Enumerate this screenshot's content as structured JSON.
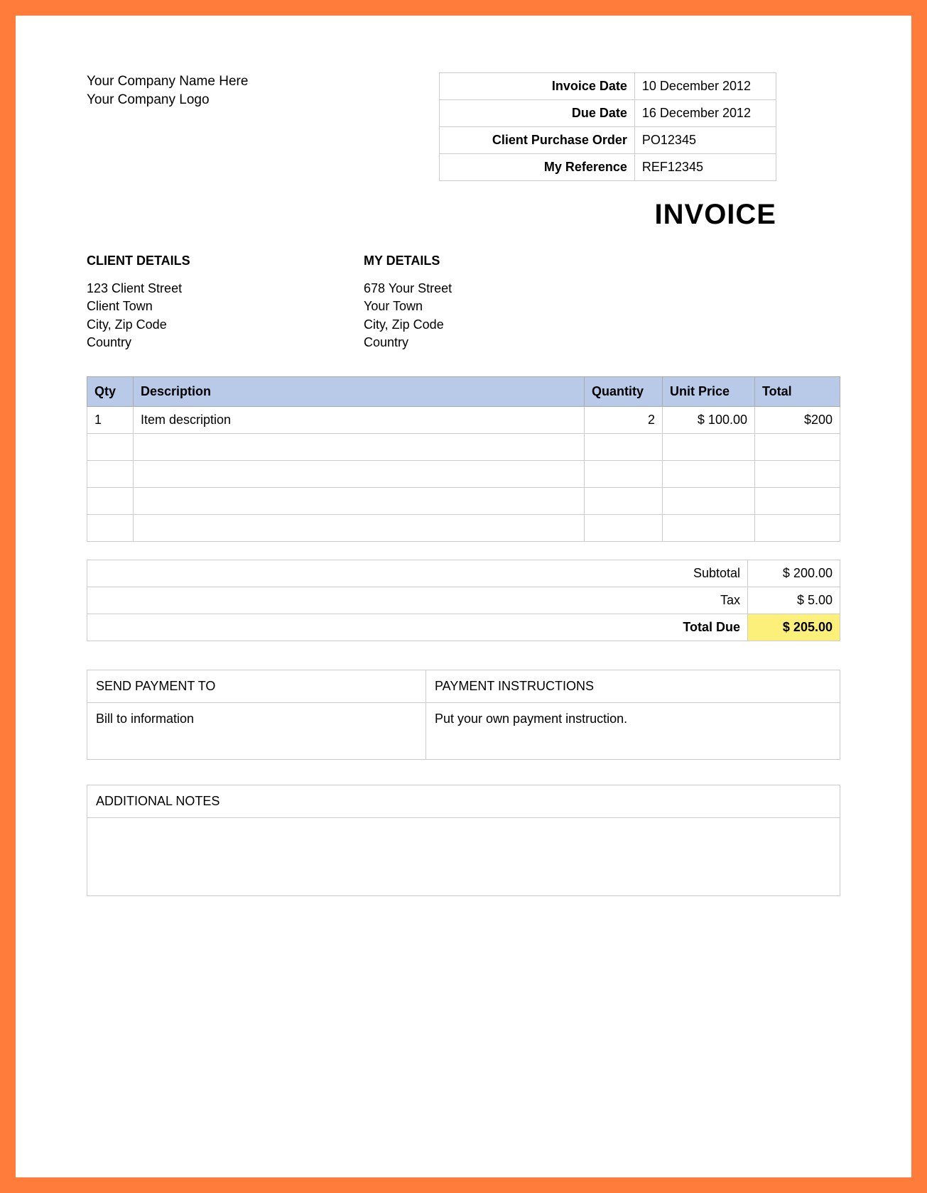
{
  "company": {
    "name_line": "Your Company Name Here",
    "logo_line": "Your Company Logo"
  },
  "meta": {
    "invoice_date_label": "Invoice Date",
    "invoice_date": "10 December  2012",
    "due_date_label": "Due Date",
    "due_date": "16 December  2012",
    "cpo_label": "Client Purchase Order",
    "cpo": "PO12345",
    "myref_label": "My Reference",
    "myref": "REF12345"
  },
  "title": "INVOICE",
  "client": {
    "heading": "CLIENT DETAILS",
    "l1": "123 Client Street",
    "l2": "Client Town",
    "l3": "City, Zip Code",
    "l4": "Country"
  },
  "mine": {
    "heading": "MY DETAILS",
    "l1": "678 Your Street",
    "l2": "Your Town",
    "l3": "City, Zip Code",
    "l4": "Country"
  },
  "columns": {
    "qty": "Qty",
    "desc": "Description",
    "quantity": "Quantity",
    "unit": "Unit Price",
    "total": "Total"
  },
  "rows": [
    {
      "qty": "1",
      "desc": "Item description",
      "quantity": "2",
      "unit": "$ 100.00",
      "total": "$200"
    },
    {
      "qty": "",
      "desc": "",
      "quantity": "",
      "unit": "",
      "total": ""
    },
    {
      "qty": "",
      "desc": "",
      "quantity": "",
      "unit": "",
      "total": ""
    },
    {
      "qty": "",
      "desc": "",
      "quantity": "",
      "unit": "",
      "total": ""
    },
    {
      "qty": "",
      "desc": "",
      "quantity": "",
      "unit": "",
      "total": ""
    }
  ],
  "totals": {
    "subtotal_label": "Subtotal",
    "subtotal": "$ 200.00",
    "tax_label": "Tax",
    "tax": "$ 5.00",
    "due_label": "Total Due",
    "due": "$ 205.00"
  },
  "payment": {
    "send_to_heading": "SEND PAYMENT TO",
    "send_to_body": "Bill to information",
    "instructions_heading": "PAYMENT INSTRUCTIONS",
    "instructions_body": "Put your own payment instruction."
  },
  "notes": {
    "heading": "ADDITIONAL NOTES",
    "body": ""
  }
}
